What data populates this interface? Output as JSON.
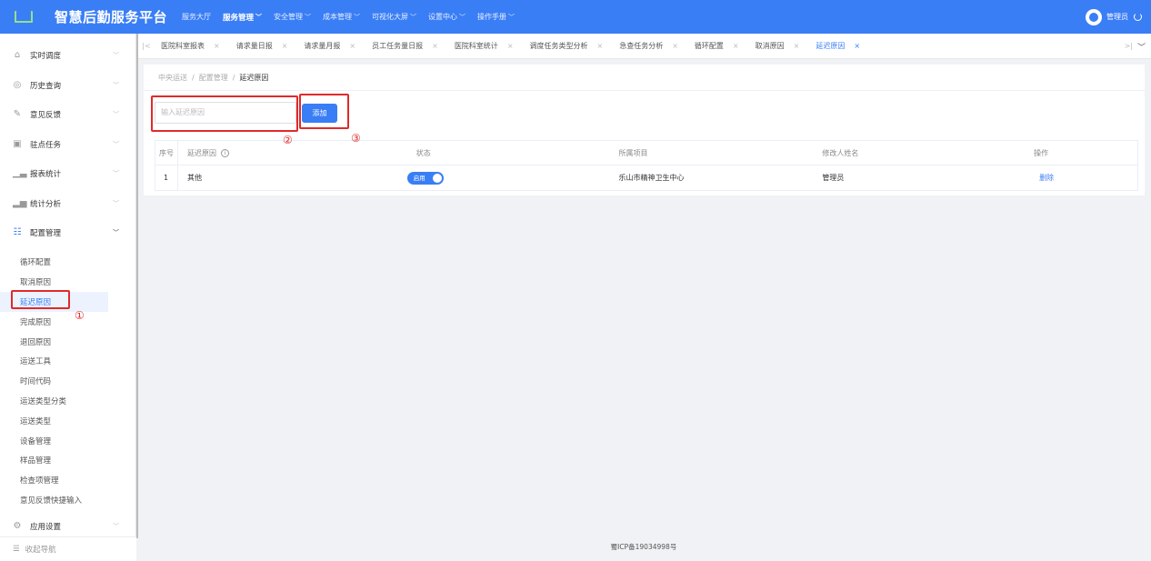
{
  "header": {
    "brand": "智慧后勤服务平台",
    "nav": [
      {
        "label": "服务大厅",
        "chevron": false,
        "active": false
      },
      {
        "label": "服务管理",
        "chevron": true,
        "active": true
      },
      {
        "label": "安全管理",
        "chevron": true,
        "active": false
      },
      {
        "label": "成本管理",
        "chevron": true,
        "active": false
      },
      {
        "label": "可视化大屏",
        "chevron": true,
        "active": false
      },
      {
        "label": "设置中心",
        "chevron": true,
        "active": false
      },
      {
        "label": "操作手册",
        "chevron": true,
        "active": false
      }
    ],
    "user": "管理员"
  },
  "sidebar": {
    "items": [
      {
        "label": "实时调度",
        "icon": "home-icon"
      },
      {
        "label": "历史查询",
        "icon": "history-icon"
      },
      {
        "label": "意见反馈",
        "icon": "edit-icon"
      },
      {
        "label": "驻点任务",
        "icon": "calendar-icon"
      },
      {
        "label": "报表统计",
        "icon": "bar-chart-icon"
      },
      {
        "label": "统计分析",
        "icon": "analysis-icon"
      },
      {
        "label": "配置管理",
        "icon": "grid-icon"
      }
    ],
    "submenu": [
      "循环配置",
      "取消原因",
      "延迟原因",
      "完成原因",
      "退回原因",
      "运送工具",
      "时间代码",
      "运送类型分类",
      "运送类型",
      "设备管理",
      "样品管理",
      "检查项管理",
      "意见反馈快捷输入"
    ],
    "active_submenu": "延迟原因",
    "app_settings": "应用设置",
    "collapse": "收起导航"
  },
  "tabs": [
    "医院科室报表",
    "请求量日报",
    "请求量月报",
    "员工任务量日报",
    "医院科室统计",
    "调度任务类型分析",
    "急查任务分析",
    "循环配置",
    "取消原因",
    "延迟原因"
  ],
  "active_tab": "延迟原因",
  "breadcrumb": {
    "l1": "中央运送",
    "l2": "配置管理",
    "current": "延迟原因"
  },
  "form": {
    "placeholder": "输入延迟原因",
    "add_label": "添加"
  },
  "annotations": {
    "a1": "①",
    "a2": "②",
    "a3": "③"
  },
  "table": {
    "columns": [
      "序号",
      "延迟原因",
      "状态",
      "所属项目",
      "修改人姓名",
      "操作"
    ],
    "rows": [
      {
        "index": "1",
        "reason": "其他",
        "status": "启用",
        "project": "乐山市精神卫生中心",
        "editor": "管理员",
        "action": "删除"
      }
    ]
  },
  "footer": "蜀ICP备19034998号",
  "colors": {
    "primary": "#3a7ef6",
    "annotation": "#e02a2a"
  }
}
